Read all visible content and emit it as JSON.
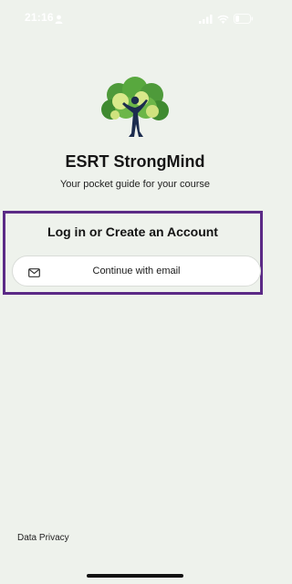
{
  "status_bar": {
    "time": "21:16"
  },
  "app": {
    "title": "ESRT StrongMind",
    "subtitle": "Your pocket guide for your course"
  },
  "login": {
    "heading": "Log in or Create an Account",
    "email_button_label": "Continue with email"
  },
  "footer": {
    "data_privacy_label": "Data Privacy"
  },
  "colors": {
    "background": "#eef2ec",
    "panel_border": "#5b2a86",
    "logo_green": "#4e9a3a",
    "logo_lime": "#d8e98a",
    "logo_navy": "#1c2c4e"
  },
  "icons": {
    "person": "person-icon",
    "signal": "signal-icon",
    "wifi": "wifi-icon",
    "battery": "battery-icon",
    "mail": "mail-icon"
  }
}
